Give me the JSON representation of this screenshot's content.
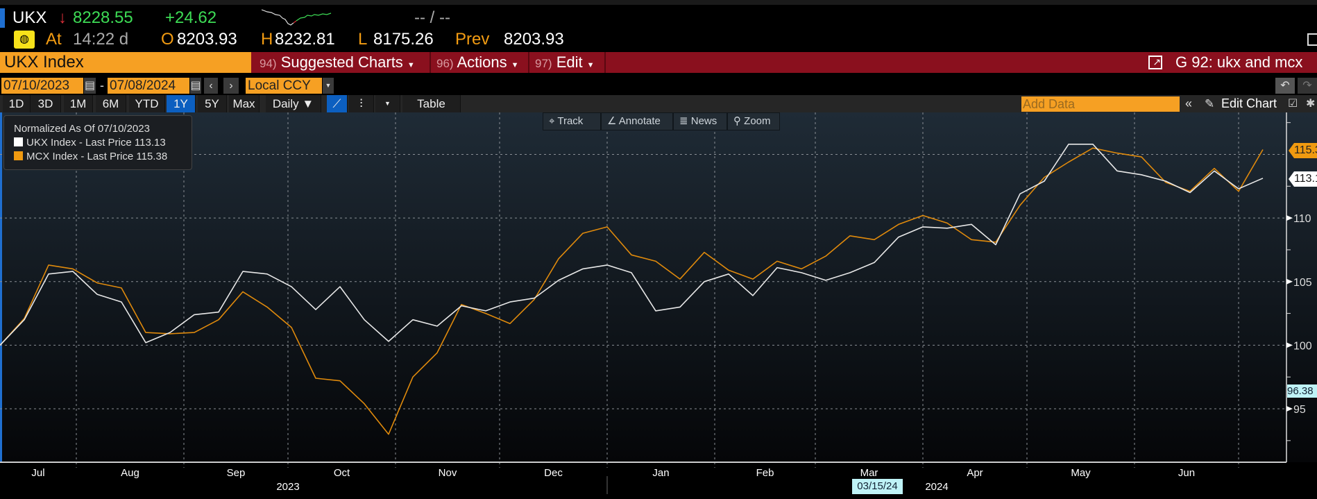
{
  "ticker": {
    "symbol": "UKX",
    "direction_icon": "down-arrow",
    "last": "8228.55",
    "change": "+24.62",
    "bid_ask": "-- / --"
  },
  "quote": {
    "at_label": "At",
    "time": "14:22 d",
    "open_label": "O",
    "open": "8203.93",
    "high_label": "H",
    "high": "8232.81",
    "low_label": "L",
    "low": "8175.26",
    "prev_label": "Prev",
    "prev": "8203.93"
  },
  "security": "UKX Index",
  "menu": [
    {
      "num": "94)",
      "label": "Suggested Charts"
    },
    {
      "num": "96)",
      "label": "Actions"
    },
    {
      "num": "97)",
      "label": "Edit"
    }
  ],
  "chart_title": "G 92: ukx and mcx",
  "dates": {
    "start": "07/10/2023",
    "end": "07/08/2024",
    "currency": "Local CCY"
  },
  "periods": [
    "1D",
    "3D",
    "1M",
    "6M",
    "YTD",
    "1Y",
    "5Y",
    "Max"
  ],
  "active_period": "1Y",
  "frequency": "Daily ▼",
  "table_label": "Table",
  "add_data_placeholder": "Add Data",
  "edit_chart_label": "Edit Chart",
  "chart_tools": [
    "Track",
    "Annotate",
    "News",
    "Zoom"
  ],
  "colors": {
    "ukx": "#e8e8e8",
    "mcx": "#e08a0c",
    "accent_orange": "#f6a023",
    "menu_red": "#8a101e",
    "active_blue": "#0c5fc0",
    "crosshair": "#bff3f7"
  },
  "crosshair": {
    "value": "96.38",
    "date": "03/15/24"
  },
  "chart_data": {
    "type": "line",
    "legend": {
      "title": "Normalized As Of 07/10/2023",
      "placement": "top-left"
    },
    "x": [
      "2023-07-10",
      "2023-07-17",
      "2023-07-24",
      "2023-07-31",
      "2023-08-07",
      "2023-08-14",
      "2023-08-21",
      "2023-08-28",
      "2023-09-04",
      "2023-09-11",
      "2023-09-18",
      "2023-09-25",
      "2023-10-02",
      "2023-10-09",
      "2023-10-16",
      "2023-10-23",
      "2023-10-30",
      "2023-11-06",
      "2023-11-13",
      "2023-11-20",
      "2023-11-27",
      "2023-12-04",
      "2023-12-11",
      "2023-12-18",
      "2023-12-25",
      "2024-01-01",
      "2024-01-08",
      "2024-01-15",
      "2024-01-22",
      "2024-01-29",
      "2024-02-05",
      "2024-02-12",
      "2024-02-19",
      "2024-02-26",
      "2024-03-04",
      "2024-03-11",
      "2024-03-18",
      "2024-03-25",
      "2024-04-01",
      "2024-04-08",
      "2024-04-15",
      "2024-04-22",
      "2024-04-29",
      "2024-05-06",
      "2024-05-13",
      "2024-05-20",
      "2024-05-27",
      "2024-06-03",
      "2024-06-10",
      "2024-06-17",
      "2024-06-24",
      "2024-07-01",
      "2024-07-08"
    ],
    "series": [
      {
        "name": "UKX Index - Last Price",
        "last": "113.13",
        "values": [
          100.0,
          102.0,
          105.6,
          105.8,
          104.0,
          103.4,
          100.2,
          101.0,
          102.4,
          102.6,
          105.8,
          105.6,
          104.6,
          102.8,
          104.6,
          102.0,
          100.3,
          102.0,
          101.5,
          103.1,
          102.7,
          103.4,
          103.7,
          105.1,
          106.0,
          106.3,
          105.7,
          102.7,
          103.0,
          105.0,
          105.6,
          103.9,
          106.1,
          105.7,
          105.1,
          105.7,
          106.5,
          108.5,
          109.3,
          109.2,
          109.5,
          107.9,
          111.9,
          112.9,
          115.8,
          115.8,
          113.7,
          113.4,
          112.9,
          112.0,
          113.7,
          112.3,
          113.13
        ]
      },
      {
        "name": "MCX Index - Last Price",
        "last": "115.38",
        "values": [
          100.0,
          102.1,
          106.3,
          106.0,
          104.9,
          104.5,
          101.0,
          100.9,
          101.0,
          102.0,
          104.2,
          103.0,
          101.4,
          97.4,
          97.2,
          95.4,
          93.0,
          97.5,
          99.4,
          103.2,
          102.5,
          101.7,
          103.6,
          106.8,
          108.8,
          109.3,
          107.1,
          106.6,
          105.2,
          107.3,
          105.9,
          105.2,
          106.6,
          106.0,
          107.0,
          108.6,
          108.3,
          109.5,
          110.2,
          109.6,
          108.3,
          108.1,
          111.0,
          113.2,
          114.4,
          115.5,
          115.1,
          114.8,
          112.8,
          112.1,
          113.9,
          112.1,
          115.38
        ]
      }
    ],
    "ylim": [
      90.8,
      118.3
    ],
    "yticks": [
      95,
      100,
      105,
      110
    ],
    "gridlines": [
      95,
      100,
      105,
      110,
      115
    ],
    "months": [
      {
        "label": "Jul",
        "start": "2023-07-10"
      },
      {
        "label": "Aug",
        "start": "2023-08-01"
      },
      {
        "label": "Sep",
        "start": "2023-09-01"
      },
      {
        "label": "Oct",
        "start": "2023-10-01"
      },
      {
        "label": "Nov",
        "start": "2023-11-01"
      },
      {
        "label": "Dec",
        "start": "2023-12-01"
      },
      {
        "label": "Jan",
        "start": "2024-01-01"
      },
      {
        "label": "Feb",
        "start": "2024-02-01"
      },
      {
        "label": "Mar",
        "start": "2024-03-01"
      },
      {
        "label": "Apr",
        "start": "2024-04-01"
      },
      {
        "label": "May",
        "start": "2024-05-01"
      },
      {
        "label": "Jun",
        "start": "2024-06-01"
      },
      {
        "label": "",
        "start": "2024-07-01"
      }
    ],
    "years": [
      {
        "label": "2023",
        "center": "2023-10-01"
      },
      {
        "label": "2024",
        "center": "2024-04-05"
      }
    ],
    "grid": true
  }
}
